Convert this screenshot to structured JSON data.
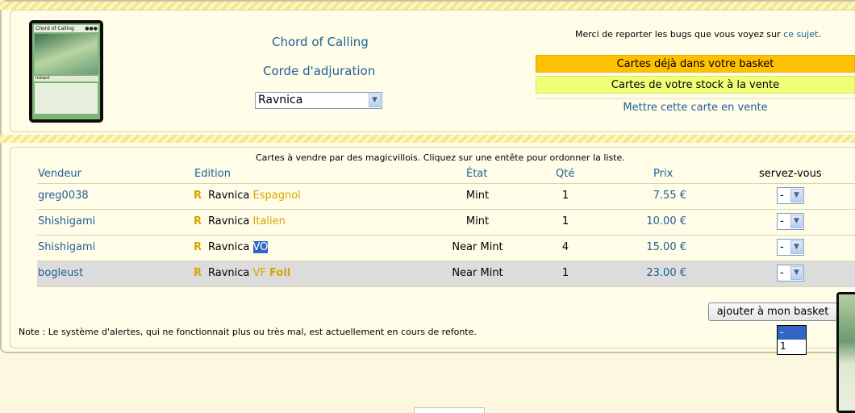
{
  "card": {
    "name_en": "Chord of Calling",
    "name_fr": "Corde d'adjuration",
    "edition_selected": "Ravnica",
    "image_title": "Chord of Calling",
    "image_pips": "●●●",
    "image_type": "Instant"
  },
  "notice": {
    "text": "Merci de reporter les bugs que vous voyez sur ",
    "link": "ce sujet",
    "end": "."
  },
  "actions": {
    "basket_label": "Cartes déjà dans votre basket",
    "stock_label": "Cartes de votre stock à la vente",
    "sell_label": "Mettre cette carte en vente"
  },
  "table": {
    "caption": "Cartes à vendre par des magicvillois. Cliquez sur une entête pour ordonner la liste.",
    "headers": {
      "seller": "Vendeur",
      "edition": "Edition",
      "condition": "État",
      "qty": "Qté",
      "price": "Prix",
      "serve": "servez-vous"
    },
    "rarity_mark": "R",
    "rows": [
      {
        "seller": "greg0038",
        "edition": "Ravnica",
        "lang": "Espagnol",
        "foil": "",
        "condition": "Mint",
        "qty": "1",
        "price": "7.55 €",
        "select": "-"
      },
      {
        "seller": "Shishigami",
        "edition": "Ravnica",
        "lang": "Italien",
        "foil": "",
        "condition": "Mint",
        "qty": "1",
        "price": "10.00 €",
        "select": "-"
      },
      {
        "seller": "Shishigami",
        "edition": "Ravnica",
        "lang": "VO",
        "foil": "",
        "condition": "Near Mint",
        "qty": "4",
        "price": "15.00 €",
        "select": "-"
      },
      {
        "seller": "bogleust",
        "edition": "Ravnica",
        "lang": "VF",
        "foil": "Foil",
        "condition": "Near Mint",
        "qty": "1",
        "price": "23.00 €",
        "select": "-"
      }
    ]
  },
  "add_button": "ajouter à mon basket",
  "note": "Note : Le système d'alertes, qui ne fonctionnait plus ou très mal, est actuellement en cours de refonte.",
  "dropdown_options": [
    "-",
    "1"
  ],
  "colors": {
    "link": "#1f5f96",
    "basket_bar": "#ffc000",
    "stock_bar": "#efff77",
    "rare": "#d9a400",
    "selection": "#3166c5"
  }
}
